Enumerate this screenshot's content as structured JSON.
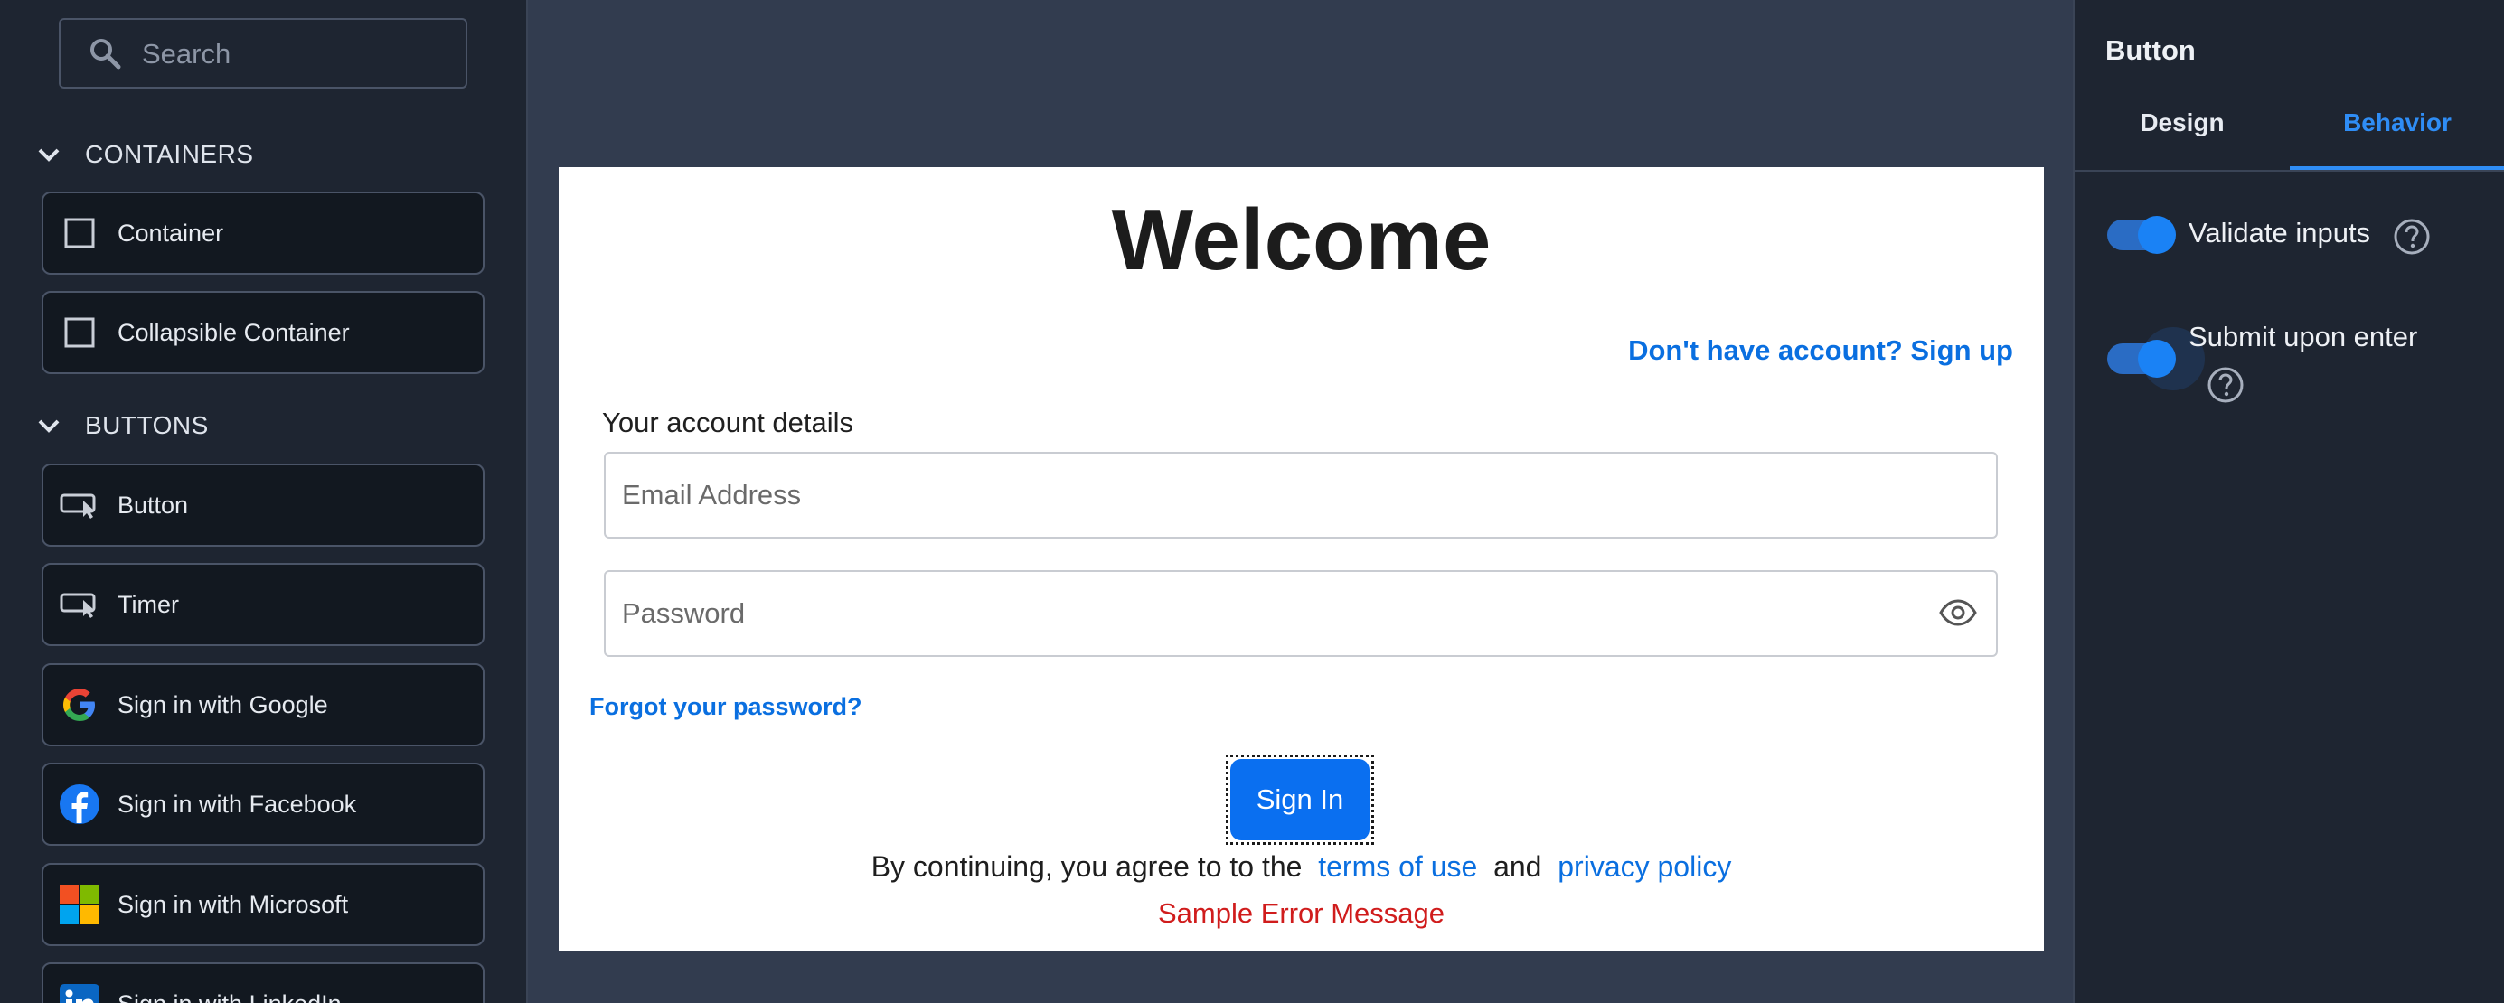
{
  "left_panel": {
    "search_placeholder": "Search",
    "sections": [
      {
        "title": "CONTAINERS",
        "items": [
          {
            "label": "Container",
            "icon": "square-icon"
          },
          {
            "label": "Collapsible Container",
            "icon": "square-icon"
          }
        ]
      },
      {
        "title": "BUTTONS",
        "items": [
          {
            "label": "Button",
            "icon": "button-cursor-icon"
          },
          {
            "label": "Timer",
            "icon": "button-cursor-icon"
          },
          {
            "label": "Sign in with Google",
            "icon": "google-icon"
          },
          {
            "label": "Sign in with Facebook",
            "icon": "facebook-icon"
          },
          {
            "label": "Sign in with Microsoft",
            "icon": "microsoft-icon"
          },
          {
            "label": "Sign in with LinkedIn",
            "icon": "linkedin-icon"
          }
        ]
      }
    ]
  },
  "form": {
    "title": "Welcome",
    "signup_link": "Don't have account? Sign up",
    "details_label": "Your account details",
    "email_placeholder": "Email Address",
    "password_placeholder": "Password",
    "forgot_link": "Forgot your password?",
    "signin_button": "Sign In",
    "terms_prefix": "By continuing, you agree to to the",
    "terms_link": "terms of use",
    "terms_and": "and",
    "privacy_link": "privacy policy",
    "error": "Sample Error Message"
  },
  "right_panel": {
    "title": "Button",
    "tabs": [
      {
        "label": "Design",
        "active": false
      },
      {
        "label": "Behavior",
        "active": true
      }
    ],
    "options": [
      {
        "label": "Validate inputs",
        "enabled": true
      },
      {
        "label": "Submit upon enter",
        "enabled": true
      }
    ]
  },
  "colors": {
    "accent": "#0a6ff0",
    "error": "#d01c1c",
    "panel": "#1e2531",
    "canvas": "#323c4f"
  }
}
